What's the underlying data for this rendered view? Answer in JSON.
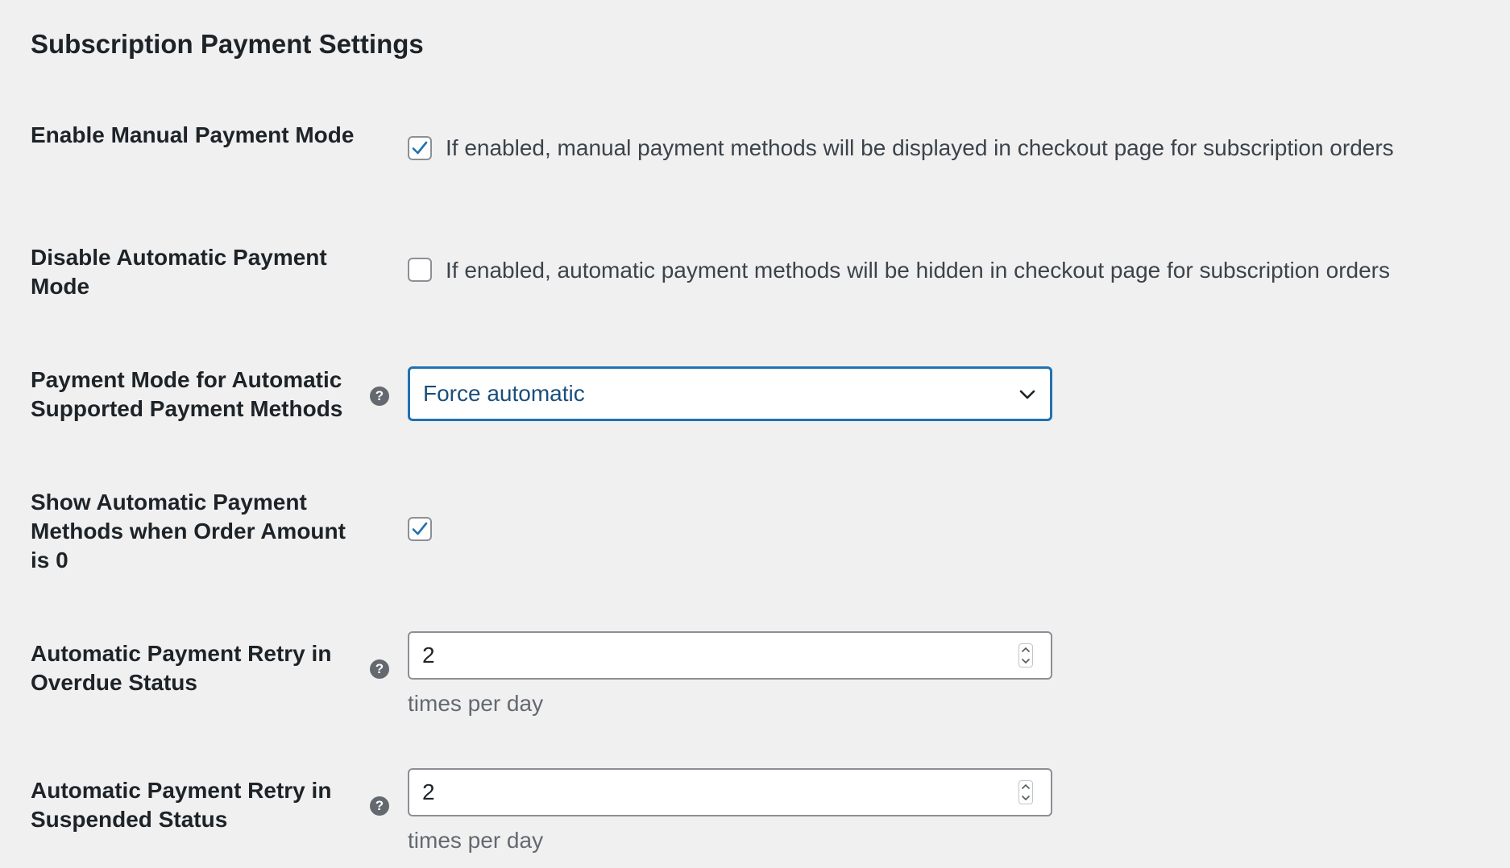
{
  "page": {
    "title": "Subscription Payment Settings"
  },
  "colors": {
    "background": "#f0f0f1",
    "accent": "#2271b1",
    "text": "#1d2327",
    "muted": "#646970"
  },
  "settings": {
    "manual_mode": {
      "label": "Enable Manual Payment Mode",
      "checked": true,
      "description": "If enabled, manual payment methods will be displayed in checkout page for subscription orders"
    },
    "disable_automatic": {
      "label": "Disable Automatic Payment Mode",
      "checked": false,
      "description": "If enabled, automatic payment methods will be hidden in checkout page for subscription orders"
    },
    "payment_mode": {
      "label": "Payment Mode for Automatic Supported Payment Methods",
      "selected": "Force automatic",
      "help_icon": "question-circle-icon"
    },
    "show_automatic_zero": {
      "label": "Show Automatic Payment Methods when Order Amount is 0",
      "checked": true
    },
    "retry_overdue": {
      "label": "Automatic Payment Retry in Overdue Status",
      "value": "2",
      "hint": "times per day",
      "help_icon": "question-circle-icon"
    },
    "retry_suspended": {
      "label": "Automatic Payment Retry in Suspended Status",
      "value": "2",
      "hint": "times per day",
      "help_icon": "question-circle-icon"
    }
  }
}
